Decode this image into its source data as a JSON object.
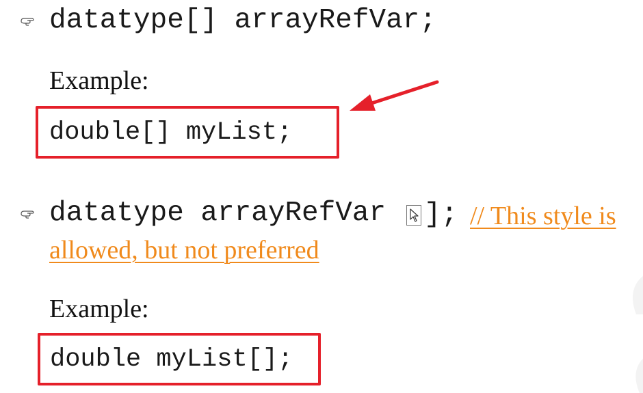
{
  "slide": {
    "syntax1": {
      "code": "datatype[] arrayRefVar;"
    },
    "example1": {
      "label": "Example:",
      "code": "double[] myList;"
    },
    "syntax2": {
      "code_before": "datatype arrayRefVar",
      "code_after": "];",
      "note_line1": "// This style is",
      "note_line2": "allowed, but not preferred"
    },
    "example2": {
      "label": "Example:",
      "code": "double myList[];"
    }
  },
  "colors": {
    "highlight_box": "#e5202a",
    "arrow": "#e5202a",
    "note": "#f08a1c"
  },
  "icons": {
    "bullet": "pointing-hand-icon",
    "annotation": "arrow-icon",
    "cursor": "mouse-cursor-icon"
  }
}
